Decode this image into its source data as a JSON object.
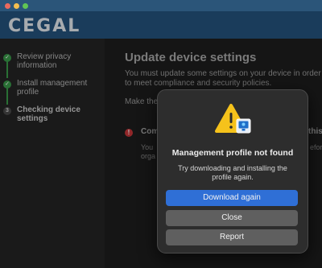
{
  "app": {
    "logo": "CEGAL"
  },
  "sidebar": {
    "steps": [
      {
        "label": "Review privacy information",
        "status": "done",
        "icon": "check-icon"
      },
      {
        "label": "Install management profile",
        "status": "done",
        "icon": "check-icon"
      },
      {
        "label": "Checking device settings",
        "status": "current",
        "number": "3"
      }
    ]
  },
  "main": {
    "title": "Update device settings",
    "description": "You must update some settings on your device in order to meet compliance and security policies.",
    "make_text": "Make the",
    "alert": {
      "icon": "alert-icon",
      "title_left": "Com",
      "title_right": "this",
      "body_left": "You\norga",
      "body_right": "efor"
    }
  },
  "dialog": {
    "icon": "warning-icon",
    "title": "Management profile not found",
    "message": "Try downloading and installing the profile again.",
    "buttons": {
      "primary": "Download again",
      "close": "Close",
      "report": "Report"
    }
  },
  "colors": {
    "header": "#24547e",
    "primary_button": "#2f6fd6",
    "success": "#3a9b4a",
    "error": "#c9363a",
    "warning": "#f5c21b"
  }
}
